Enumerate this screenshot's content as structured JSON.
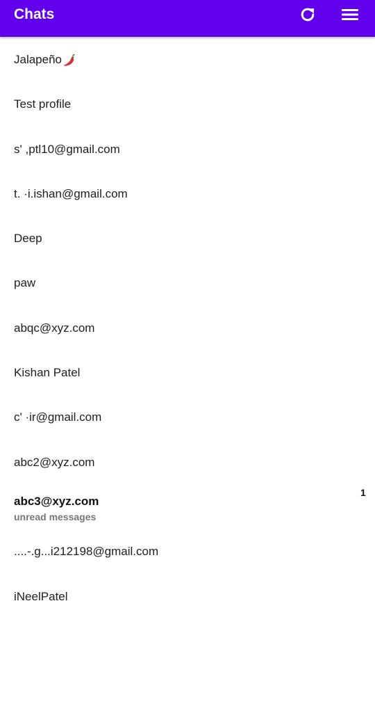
{
  "header": {
    "title": "Chats",
    "icons": [
      "refresh-icon",
      "menu-icon"
    ],
    "background": "#6200ee"
  },
  "chats": [
    {
      "name": "Jalapeño",
      "emoji": "chili-pepper-icon"
    },
    {
      "name": "Test profile"
    },
    {
      "name": "s'    ,ptl10@gmail.com"
    },
    {
      "name": "t.         ·i.ishan@gmail.com"
    },
    {
      "name": "Deep"
    },
    {
      "name": "paw"
    },
    {
      "name": "abqc@xyz.com"
    },
    {
      "name": "Kishan Patel"
    },
    {
      "name": "c'          ·ir@gmail.com"
    },
    {
      "name": "abc2@xyz.com"
    },
    {
      "name": "abc3@xyz.com",
      "subtitle": "unread messages",
      "unread_count": "1"
    },
    {
      "name": "....-.g...i212198@gmail.com"
    },
    {
      "name": "iNeelPatel"
    }
  ]
}
